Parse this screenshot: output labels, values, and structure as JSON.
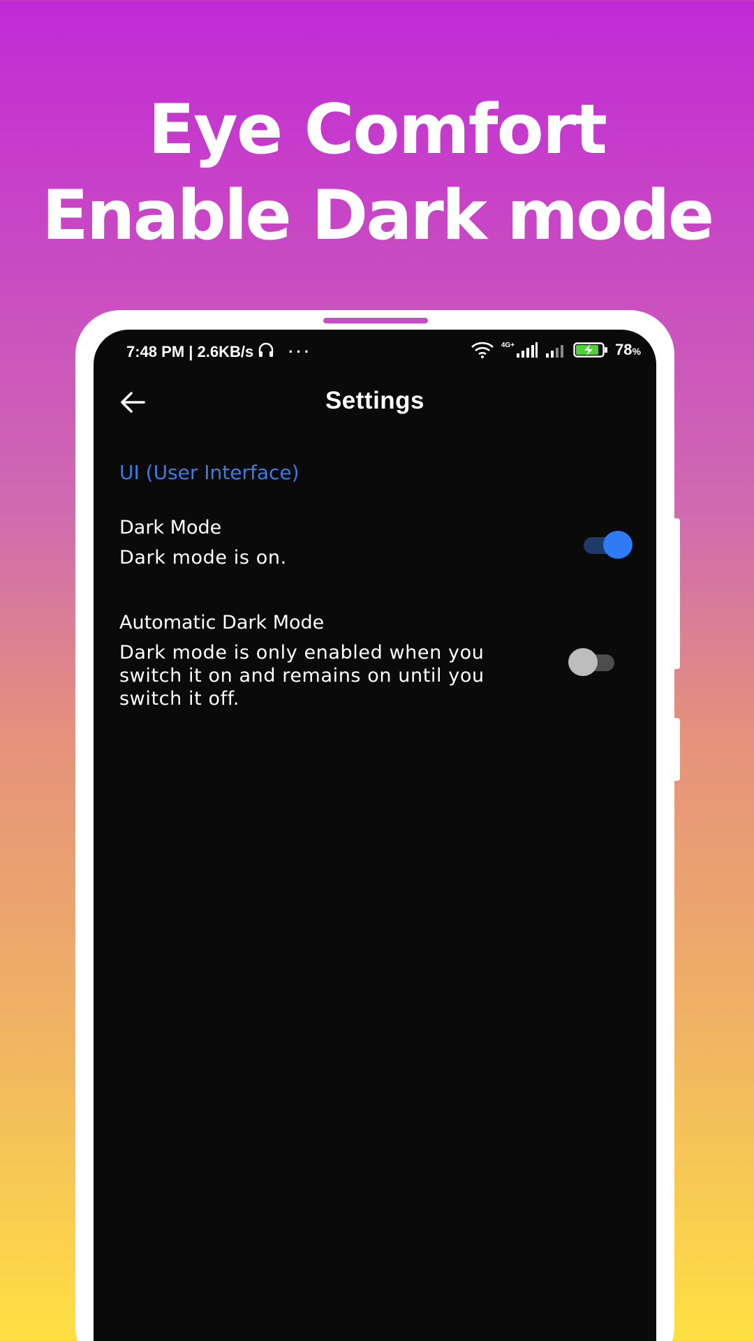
{
  "promo": {
    "line1": "Eye Comfort",
    "line2": "Enable Dark mode"
  },
  "statusbar": {
    "time_speed": "7:48 PM | 2.6KB/s",
    "dots": "···",
    "network_label": "4G+",
    "battery_percent": "78",
    "percent_sign": "%"
  },
  "appbar": {
    "title": "Settings"
  },
  "section": {
    "header": "UI (User Interface)"
  },
  "settings": [
    {
      "title": "Dark Mode",
      "summary": "Dark mode is on.",
      "enabled": true
    },
    {
      "title": "Automatic Dark Mode",
      "summary": "Dark mode is only enabled when you switch it on and remains on until you switch it off.",
      "enabled": false
    }
  ],
  "colors": {
    "accent": "#3D7BE6",
    "switch_on": "#2F7BF5",
    "screen_bg": "#0A0A0A"
  }
}
